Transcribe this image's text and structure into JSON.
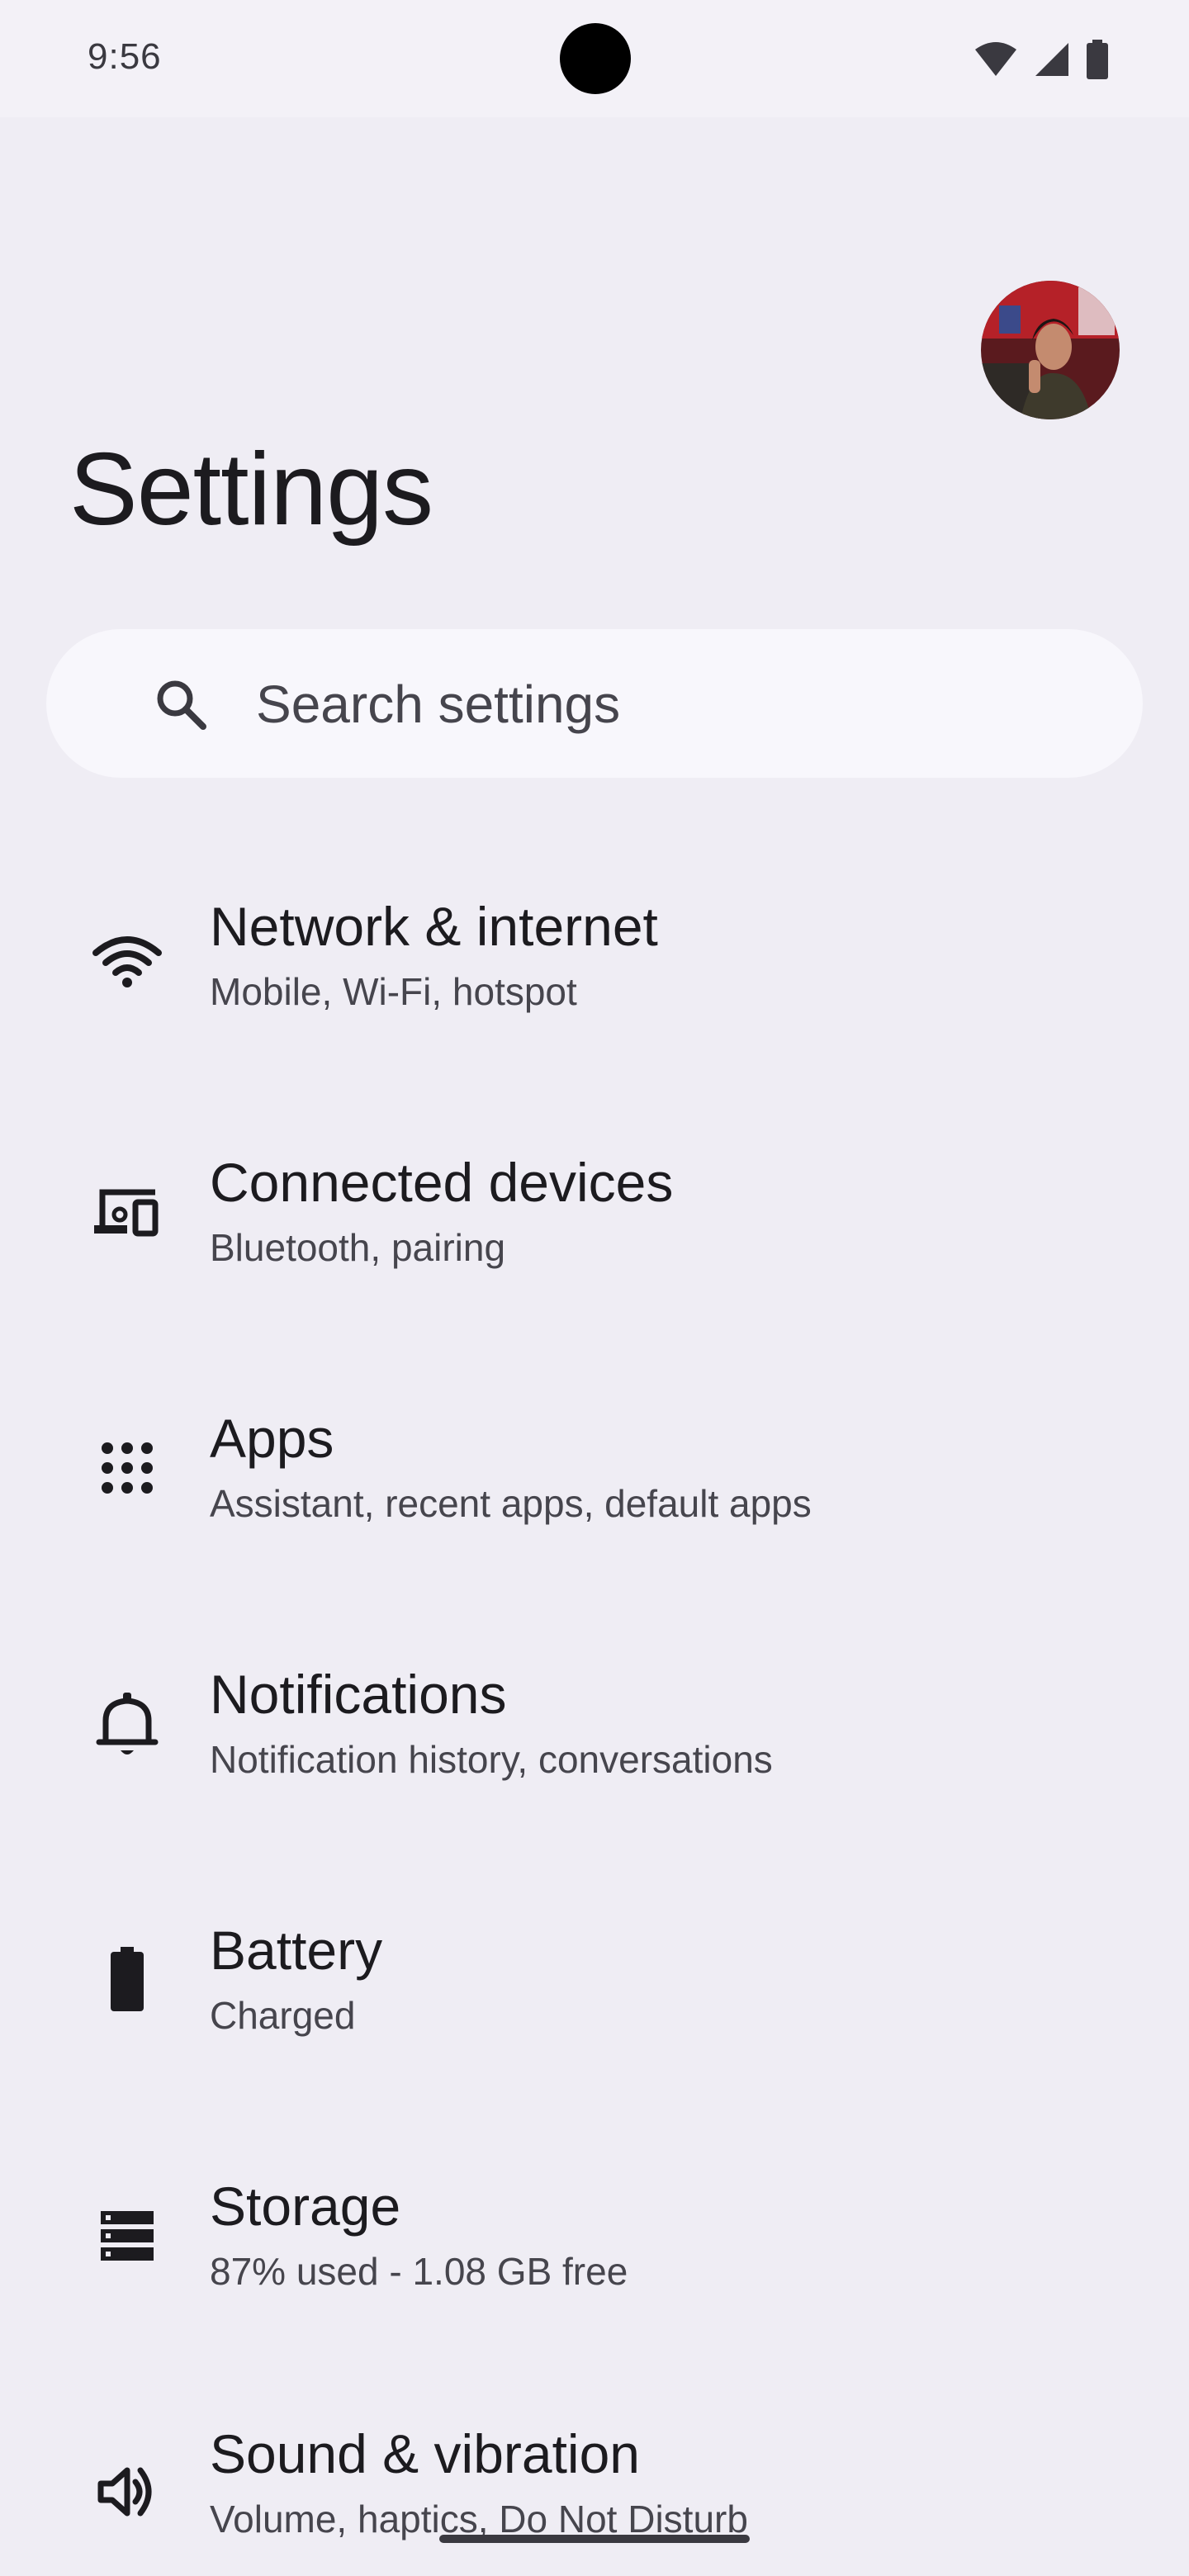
{
  "status_bar": {
    "time": "9:56",
    "icons": [
      "wifi-icon",
      "cellular-signal-icon",
      "battery-icon"
    ]
  },
  "header": {
    "title": "Settings",
    "avatar": "profile-avatar"
  },
  "search": {
    "placeholder": "Search settings",
    "icon": "search-icon"
  },
  "items": [
    {
      "title": "Network & internet",
      "subtitle": "Mobile, Wi-Fi, hotspot",
      "icon": "wifi-icon"
    },
    {
      "title": "Connected devices",
      "subtitle": "Bluetooth, pairing",
      "icon": "connected-devices-icon"
    },
    {
      "title": "Apps",
      "subtitle": "Assistant, recent apps, default apps",
      "icon": "apps-grid-icon"
    },
    {
      "title": "Notifications",
      "subtitle": "Notification history, conversations",
      "icon": "bell-icon"
    },
    {
      "title": "Battery",
      "subtitle": "Charged",
      "icon": "battery-icon"
    },
    {
      "title": "Storage",
      "subtitle": "87% used - 1.08 GB free",
      "icon": "storage-icon"
    },
    {
      "title": "Sound & vibration",
      "subtitle": "Volume, haptics, Do Not Disturb",
      "icon": "volume-icon"
    }
  ],
  "colors": {
    "background": "#efedf4",
    "search_background": "#f8f7fc",
    "text_primary": "#1c1b1f",
    "text_secondary": "#46454d"
  }
}
